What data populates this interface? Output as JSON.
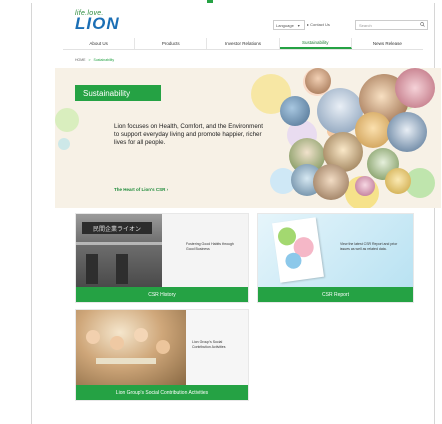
{
  "header": {
    "tagline": "life.love.",
    "logo_text": "LION",
    "language_label": "Language",
    "language_caret": "▾",
    "contact_label": "▸ Contact Us",
    "search_placeholder": "Search"
  },
  "nav": {
    "items": [
      {
        "label": "About Us"
      },
      {
        "label": "Products"
      },
      {
        "label": "Investor Relations"
      },
      {
        "label": "Sustainability"
      },
      {
        "label": "News Release"
      }
    ],
    "active_index": 3
  },
  "breadcrumb": {
    "home": "HOME",
    "separator": ">",
    "current": "Sustainability"
  },
  "hero": {
    "badge": "Sustainability",
    "text": "Lion focuses on Health, Comfort, and the Environment to support everyday living and promote happier, richer lives for all people.",
    "link": "The Heart of Lion's CSR  ›"
  },
  "cards": [
    {
      "title": "CSR History",
      "desc": "Fostering Good Habits through Good Business",
      "sign_text": "民間企業ライオン"
    },
    {
      "title": "CSR Report",
      "desc": "View the latest CSR Report and prior issues as well as related data."
    },
    {
      "title": "Lion Group's Social Contribution Activities",
      "desc": "Lion Group's Social Contribution Activities"
    }
  ],
  "colors": {
    "brand_green": "#25a244",
    "logo_blue": "#1b6fb5",
    "hero_bg": "#f7f1e6"
  },
  "icons": {
    "search": "search-icon"
  }
}
